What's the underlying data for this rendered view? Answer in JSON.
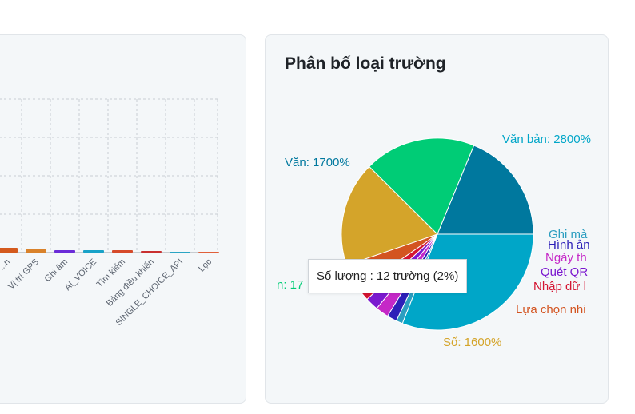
{
  "bar_card": {
    "categories": [
      "...n",
      "Vị trí GPS",
      "Ghi âm",
      "AI_VOICE",
      "Tìm kiếm",
      "Bảng điều khiển",
      "SINGLE_CHOICE_API",
      "Lọc"
    ],
    "colors": [
      "#d45a1e",
      "#d9822b",
      "#6a2bd8",
      "#18a2c8",
      "#d64a2a",
      "#c93030",
      "#2ba5c4",
      "#e0603a"
    ]
  },
  "pie_card": {
    "title": "Phân bố loại trường",
    "tooltip": {
      "label": "Số lượng",
      "value_text": ": 12 trường (2%)"
    }
  },
  "chart_data": [
    {
      "type": "bar",
      "categories": [
        "...n",
        "Vị trí GPS",
        "Ghi âm",
        "AI_VOICE",
        "Tìm kiếm",
        "Bảng điều khiển",
        "SINGLE_CHOICE_API",
        "Lọc"
      ],
      "values": [
        6,
        4,
        3,
        3,
        3,
        2,
        1,
        1
      ],
      "grid": true
    },
    {
      "type": "pie",
      "title": "Phân bố loại trường",
      "slices": [
        {
          "label": "Văn bản: 2800%",
          "value": 28,
          "color": "#00a6c8"
        },
        {
          "label": "Ghi mà...",
          "value": 1,
          "color": "#2d9ec0"
        },
        {
          "label": "Hình ả...",
          "value": 1.5,
          "color": "#2c1fb8"
        },
        {
          "label": "Ngày th...",
          "value": 2,
          "color": "#c528c7"
        },
        {
          "label": "Quét QR...",
          "value": 2,
          "color": "#7b18cf"
        },
        {
          "label": "Nhập dữ l...",
          "value": 2,
          "color": "#d41431"
        },
        {
          "label": "Lựa chọn nhi...",
          "value": 4,
          "color": "#d35420"
        },
        {
          "label": "Số: 1600%",
          "value": 16,
          "color": "#d4a42a"
        },
        {
          "label": "...n: 1700%",
          "value": 17,
          "color": "#00cc76"
        },
        {
          "label": "...Văn: 1700%",
          "value": 17,
          "color": "#00789e"
        }
      ],
      "visible_labels": [
        {
          "text": "Văn bản: 2800%",
          "color": "#00a6c8"
        },
        {
          "text": "Ghi mà",
          "color": "#2d9ec0"
        },
        {
          "text": "Hình ản",
          "color": "#2c1fb8"
        },
        {
          "text": "Ngày th",
          "color": "#c528c7"
        },
        {
          "text": "Quét QR",
          "color": "#7b18cf"
        },
        {
          "text": "Nhập dữ l",
          "color": "#d41431"
        },
        {
          "text": "Lựa chọn nhi",
          "color": "#d35420"
        },
        {
          "text": "Số: 1600%",
          "color": "#d4a42a"
        },
        {
          "text": "n: 17",
          "color": "#00cc76"
        },
        {
          "text": "Văn: 1700%",
          "color": "#00789e"
        }
      ]
    }
  ]
}
